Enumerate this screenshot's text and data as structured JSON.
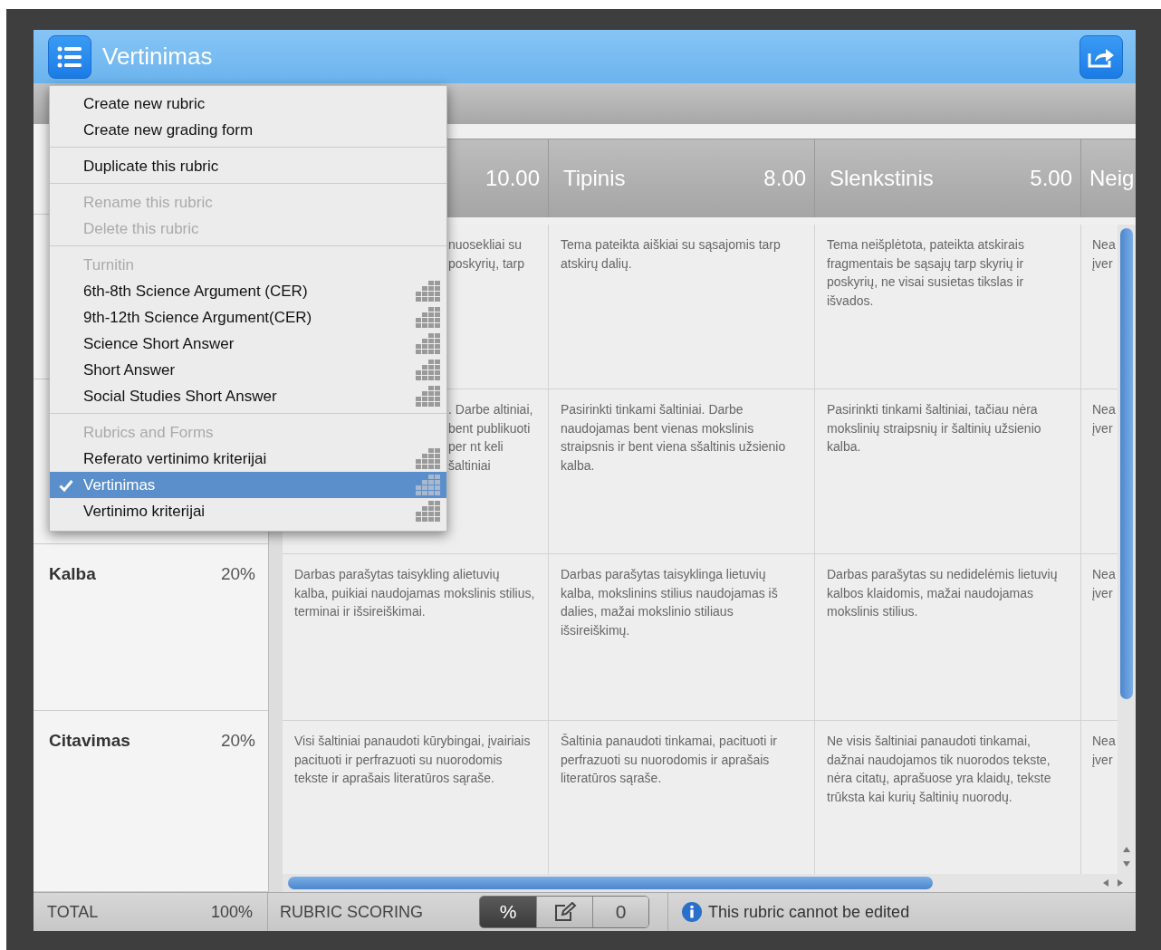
{
  "header": {
    "title": "Vertinimas"
  },
  "columns": [
    {
      "points": "10.00"
    },
    {
      "title": "Tipinis",
      "points": "8.00"
    },
    {
      "title": "Slenkstinis",
      "points": "5.00"
    },
    {
      "title": "Neig"
    }
  ],
  "rows": [
    {
      "cells": [
        "nuosekliai su poskyrių, tarp",
        "Tema pateikta aiškiai su sąsajomis tarp atskirų dalių.",
        "Tema neišplėtota, pateikta atskirais fragmentais be sąsajų tarp skyrių ir poskyrių, ne visai susietas tikslas ir išvados.",
        "Nea įver"
      ]
    },
    {
      "cells": [
        ". Darbe altiniai, bent publikuoti per nt keli šaltiniai",
        "Pasirinkti tinkami šaltiniai. Darbe naudojamas bent vienas mokslinis straipsnis ir bent viena sšaltinis užsienio kalba.",
        "Pasirinkti tinkami šaltiniai, tačiau nėra mokslinių straipsnių ir šaltinių užsienio kalba.",
        "Nea įver"
      ]
    },
    {
      "name": "Kalba",
      "weight": "20%",
      "cells": [
        "Darbas parašytas taisykling alietuvių kalba, puikiai naudojamas mokslinis stilius, terminai ir išsireiškimai.",
        "Darbas parašytas taisyklinga lietuvių kalba, mokslinins stilius naudojamas iš dalies, mažai mokslinio stiliaus išsireiškimų.",
        "Darbas parašytas su nedidelėmis lietuvių kalbos klaidomis, mažai naudojamas mokslinis stilius.",
        "Nea įver"
      ]
    },
    {
      "name": "Citavimas",
      "weight": "20%",
      "cells": [
        "Visi šaltiniai panaudoti kūrybingai, įvairiais pacituoti ir perfrazuoti su nuorodomis tekste ir aprašais literatūros sąraše.",
        "Šaltinia panaudoti tinkamai, pacituoti ir perfrazuoti su nuorodomis ir aprašais literatūros sąraše.",
        "Ne visis šaltiniai panaudoti tinkamai, dažnai naudojamos tik nuorodos tekste, nėra citatų, aprašuose yra klaidų, tekste trūksta kai kurių šaltinių nuorodų.",
        "Nea įver"
      ]
    }
  ],
  "footer": {
    "total_label": "TOTAL",
    "total_value": "100%",
    "scoring_label": "RUBRIC SCORING",
    "scoring_modes": [
      {
        "kind": "text",
        "label": "%",
        "selected": true
      },
      {
        "kind": "edit",
        "selected": false
      },
      {
        "kind": "text",
        "label": "0",
        "selected": false
      }
    ],
    "notice": "This rubric cannot be edited"
  },
  "menu": {
    "groups": [
      {
        "items": [
          {
            "kind": "action",
            "label": "Create new rubric",
            "disabled": false
          },
          {
            "kind": "action",
            "label": "Create new grading form",
            "disabled": false
          }
        ]
      },
      {
        "items": [
          {
            "kind": "action",
            "label": "Duplicate this rubric",
            "disabled": false
          }
        ]
      },
      {
        "items": [
          {
            "kind": "action",
            "label": "Rename this rubric",
            "disabled": true
          },
          {
            "kind": "action",
            "label": "Delete this rubric",
            "disabled": true
          }
        ]
      },
      {
        "heading": "Turnitin",
        "items": [
          {
            "kind": "rubric",
            "label": "6th-8th Science Argument (CER)",
            "selected": false
          },
          {
            "kind": "rubric",
            "label": "9th-12th Science Argument(CER)",
            "selected": false
          },
          {
            "kind": "rubric",
            "label": "Science Short Answer",
            "selected": false
          },
          {
            "kind": "rubric",
            "label": "Short Answer",
            "selected": false
          },
          {
            "kind": "rubric",
            "label": "Social Studies Short Answer",
            "selected": false
          }
        ]
      },
      {
        "heading": "Rubrics and Forms",
        "items": [
          {
            "kind": "rubric",
            "label": "Referato vertinimo kriterijai",
            "selected": false
          },
          {
            "kind": "rubric",
            "label": "Vertinimas",
            "selected": true
          },
          {
            "kind": "rubric",
            "label": "Vertinimo kriterijai",
            "selected": false
          }
        ]
      }
    ]
  }
}
